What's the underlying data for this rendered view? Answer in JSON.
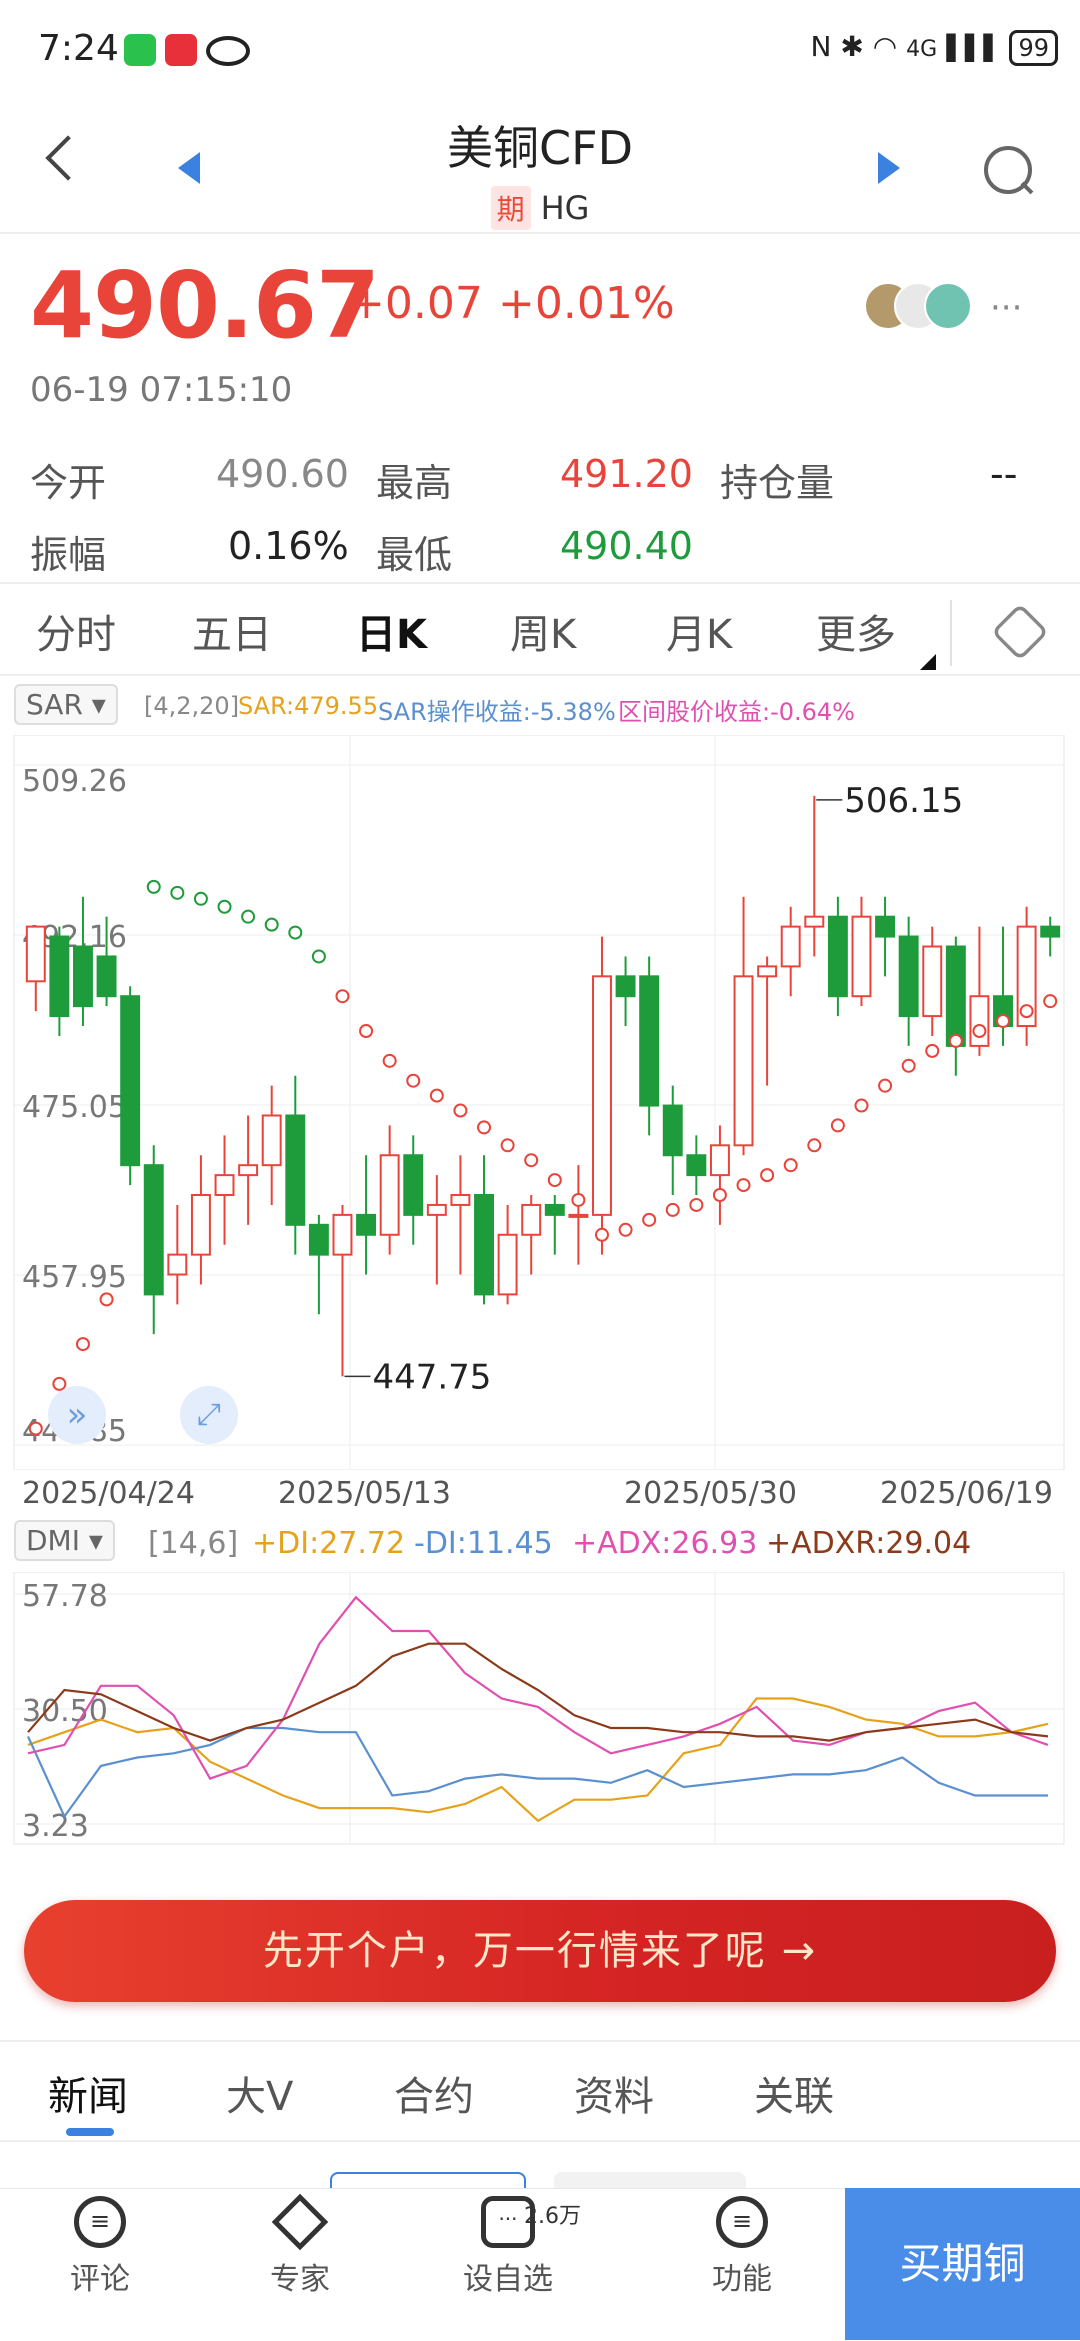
{
  "status_bar": {
    "time": "7:24",
    "battery": "99",
    "network": "4G"
  },
  "header": {
    "title": "美铜CFD",
    "badge": "期",
    "code": "HG"
  },
  "quote": {
    "price": "490.67",
    "change": "+0.07",
    "change_pct": "+0.01%",
    "timestamp": "06-19 07:15:10",
    "open_label": "今开",
    "open": "490.60",
    "high_label": "最高",
    "high": "491.20",
    "oi_label": "持仓量",
    "oi": "--",
    "amp_label": "振幅",
    "amp": "0.16%",
    "low_label": "最低",
    "low": "490.40"
  },
  "colors": {
    "up": "#e8443a",
    "down": "#1e9c3c",
    "accent": "#4a8de8",
    "sar": "#e8443a"
  },
  "tabs": [
    "分时",
    "五日",
    "日K",
    "周K",
    "月K",
    "更多"
  ],
  "active_tab": "日K",
  "sar_bar": {
    "name": "SAR",
    "params": "[4,2,20]",
    "sar": "SAR:479.55",
    "sar_yield": "SAR操作收益:-5.38%",
    "range_yield": "区间股价收益:-0.64%"
  },
  "dmi_bar": {
    "name": "DMI",
    "params": "[14,6]",
    "pdi": "+DI:27.72",
    "mdi": "-DI:11.45",
    "adx": "+ADX:26.93",
    "adxr": "+ADXR:29.04"
  },
  "chart_data": [
    {
      "type": "candlestick",
      "ylim": [
        440.85,
        509.26
      ],
      "y_ticks": [
        "509.26",
        "492.16",
        "475.05",
        "457.95",
        "440.85"
      ],
      "x_ticks": [
        "2025/04/24",
        "2025/05/13",
        "2025/05/30",
        "2025/06/19"
      ],
      "max_label": "506.15",
      "min_label": "447.75",
      "candles": [
        [
          487.5,
          493,
          484.5,
          492.5
        ],
        [
          492,
          484,
          493,
          482
        ],
        [
          491,
          485,
          496,
          483
        ],
        [
          490,
          486,
          494,
          485
        ],
        [
          486,
          469,
          487,
          467
        ],
        [
          469,
          456,
          471,
          452
        ],
        [
          458,
          460,
          465,
          455
        ],
        [
          460,
          466,
          470,
          457
        ],
        [
          466,
          468,
          472,
          461
        ],
        [
          468,
          469,
          474,
          463
        ],
        [
          469,
          474,
          477,
          465
        ],
        [
          474,
          463,
          478,
          460
        ],
        [
          463,
          460,
          464,
          454
        ],
        [
          460,
          464,
          465,
          447.75
        ],
        [
          464,
          462,
          470,
          458
        ],
        [
          462,
          470,
          473,
          460
        ],
        [
          470,
          464,
          472,
          461
        ],
        [
          464,
          465,
          468,
          457
        ],
        [
          465,
          466,
          470,
          458
        ],
        [
          466,
          456,
          470,
          455
        ],
        [
          456,
          462,
          465,
          455
        ],
        [
          462,
          465,
          466,
          458
        ],
        [
          465,
          464,
          466,
          460
        ],
        [
          464,
          464,
          469,
          459
        ],
        [
          464,
          488,
          492,
          460
        ],
        [
          488,
          486,
          490,
          483
        ],
        [
          488,
          475,
          490,
          472
        ],
        [
          475,
          470,
          477,
          466
        ],
        [
          470,
          468,
          472,
          466
        ],
        [
          468,
          471,
          473,
          463
        ],
        [
          471,
          488,
          496,
          470
        ],
        [
          488,
          489,
          490,
          477
        ],
        [
          489,
          493,
          495,
          486
        ],
        [
          493,
          494,
          506.15,
          490
        ],
        [
          494,
          486,
          496,
          484
        ],
        [
          486,
          494,
          496,
          485
        ],
        [
          494,
          492,
          496,
          488
        ],
        [
          492,
          484,
          494,
          481
        ],
        [
          484,
          491,
          493,
          482
        ],
        [
          491,
          481,
          492,
          478
        ],
        [
          481,
          486,
          493,
          480
        ],
        [
          486,
          483,
          493,
          481
        ],
        [
          483,
          493,
          495,
          481
        ],
        [
          493,
          492,
          494,
          490
        ]
      ],
      "sar": [
        [
          0,
          442.5
        ],
        [
          1,
          447
        ],
        [
          2,
          451
        ],
        [
          3,
          455.5
        ],
        [
          5,
          497
        ],
        [
          6,
          496.4
        ],
        [
          7,
          495.8
        ],
        [
          8,
          495
        ],
        [
          9,
          494
        ],
        [
          10,
          493.2
        ],
        [
          11,
          492.4
        ],
        [
          12,
          490
        ],
        [
          13,
          486
        ],
        [
          14,
          482.5
        ],
        [
          15,
          479.5
        ],
        [
          16,
          477.5
        ],
        [
          17,
          476
        ],
        [
          18,
          474.5
        ],
        [
          19,
          472.8
        ],
        [
          20,
          471
        ],
        [
          21,
          469.5
        ],
        [
          22,
          467.5
        ],
        [
          23,
          465.5
        ],
        [
          24,
          462
        ],
        [
          25,
          462.5
        ],
        [
          26,
          463.5
        ],
        [
          27,
          464.5
        ],
        [
          28,
          465
        ],
        [
          29,
          466
        ],
        [
          30,
          467
        ],
        [
          31,
          468
        ],
        [
          32,
          469
        ],
        [
          33,
          471
        ],
        [
          34,
          473
        ],
        [
          35,
          475
        ],
        [
          36,
          477
        ],
        [
          37,
          479
        ],
        [
          38,
          480.5
        ],
        [
          39,
          481.5
        ],
        [
          40,
          482.5
        ],
        [
          41,
          483.5
        ],
        [
          42,
          484.5
        ],
        [
          43,
          485.5
        ]
      ]
    },
    {
      "type": "line",
      "ylim": [
        3.23,
        57.78
      ],
      "y_ticks": [
        "57.78",
        "30.50",
        "3.23"
      ],
      "series": [
        {
          "name": "+DI",
          "color": "#e5a21a",
          "values": [
            22,
            25,
            28,
            25,
            26,
            18,
            14,
            10,
            7,
            7,
            7,
            6,
            8,
            12,
            4,
            9,
            9,
            10,
            20,
            22,
            33,
            33,
            31,
            28,
            27,
            24,
            24,
            25,
            27
          ]
        },
        {
          "name": "-DI",
          "color": "#5a8fd0",
          "values": [
            24,
            5,
            17,
            19,
            20,
            22,
            26,
            26,
            25,
            25,
            10,
            11,
            14,
            15,
            14,
            14,
            13,
            16,
            12,
            13,
            14,
            15,
            15,
            16,
            19,
            13,
            10,
            10,
            10
          ]
        },
        {
          "name": "+ADX",
          "color": "#e050b0",
          "values": [
            20,
            22,
            36,
            36,
            29,
            14,
            17,
            28,
            46,
            57,
            49,
            49,
            39,
            33,
            31,
            25,
            20,
            22,
            24,
            27,
            31,
            23,
            22,
            25,
            26,
            30,
            32,
            25,
            22
          ]
        },
        {
          "name": "+ADXR",
          "color": "#8b3a1a",
          "values": [
            25,
            35,
            34,
            30,
            26,
            23,
            26,
            28,
            32,
            36,
            43,
            46,
            46,
            40,
            35,
            29,
            26,
            26,
            25,
            25,
            24,
            24,
            23,
            25,
            26,
            27,
            28,
            25,
            24
          ]
        }
      ]
    }
  ],
  "banner": {
    "text": "先开个户，万一行情来了呢 →"
  },
  "news_tabs": [
    "新闻",
    "大V",
    "合约",
    "资料",
    "关联"
  ],
  "bottom_nav": {
    "comment": "评论",
    "expert": "专家",
    "watch": "设自选",
    "watch_count": "2.6万",
    "func": "功能",
    "buy": "买期铜"
  }
}
